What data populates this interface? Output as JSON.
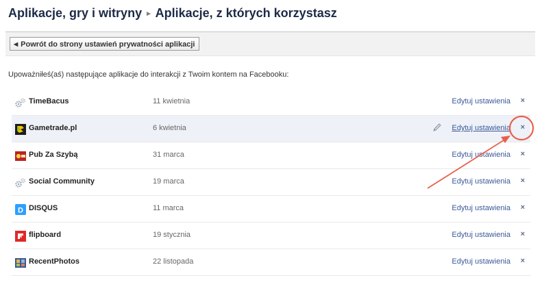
{
  "breadcrumb": {
    "parent": "Aplikacje, gry i witryny",
    "separator": "▸",
    "current": "Aplikacje, z których korzystasz"
  },
  "toolbar": {
    "back_label": "Powrót do strony ustawień prywatności aplikacji"
  },
  "intro_text": "Upoważniłeś(aś) następujące aplikacje do interakcji z Twoim kontem na Facebooku:",
  "edit_label": "Edytuj ustawienia",
  "remove_symbol": "×",
  "apps": [
    {
      "name": "TimeBacus",
      "date": "11 kwietnia",
      "icon": "gears-icon"
    },
    {
      "name": "Gametrade.pl",
      "date": "6 kwietnia",
      "icon": "gametrade-icon",
      "highlighted": true
    },
    {
      "name": "Pub Za Szybą",
      "date": "31 marca",
      "icon": "pub-icon"
    },
    {
      "name": "Social Community",
      "date": "19 marca",
      "icon": "gears-icon"
    },
    {
      "name": "DISQUS",
      "date": "11 marca",
      "icon": "disqus-icon",
      "icon_letter": "D"
    },
    {
      "name": "flipboard",
      "date": "19 stycznia",
      "icon": "flipboard-icon"
    },
    {
      "name": "RecentPhotos",
      "date": "22 listopada",
      "icon": "recentphotos-icon"
    }
  ],
  "colors": {
    "title": "#1c2a47",
    "link": "#3b5998",
    "highlight_row": "#eef1f7",
    "annotation": "#e8604c"
  }
}
